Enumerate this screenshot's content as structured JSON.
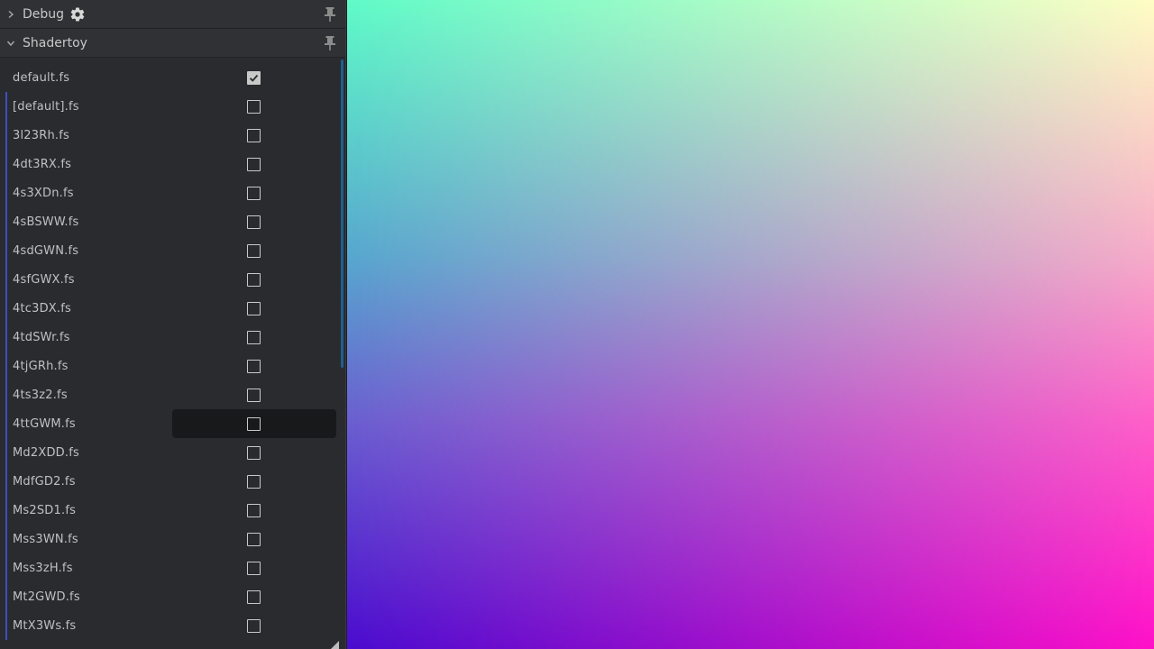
{
  "sections": {
    "debug": {
      "title": "Debug",
      "expanded": false
    },
    "shadertoy": {
      "title": "Shadertoy",
      "expanded": true
    }
  },
  "shaders": [
    {
      "name": "default.fs",
      "checked": true
    },
    {
      "name": "[default].fs",
      "checked": false
    },
    {
      "name": "3l23Rh.fs",
      "checked": false
    },
    {
      "name": "4dt3RX.fs",
      "checked": false
    },
    {
      "name": "4s3XDn.fs",
      "checked": false
    },
    {
      "name": "4sBSWW.fs",
      "checked": false
    },
    {
      "name": "4sdGWN.fs",
      "checked": false
    },
    {
      "name": "4sfGWX.fs",
      "checked": false
    },
    {
      "name": "4tc3DX.fs",
      "checked": false
    },
    {
      "name": "4tdSWr.fs",
      "checked": false
    },
    {
      "name": "4tjGRh.fs",
      "checked": false
    },
    {
      "name": "4ts3z2.fs",
      "checked": false
    },
    {
      "name": "4ttGWM.fs",
      "checked": false,
      "hovered": true
    },
    {
      "name": "Md2XDD.fs",
      "checked": false
    },
    {
      "name": "MdfGD2.fs",
      "checked": false
    },
    {
      "name": "Ms2SD1.fs",
      "checked": false
    },
    {
      "name": "Mss3WN.fs",
      "checked": false
    },
    {
      "name": "Mss3zH.fs",
      "checked": false
    },
    {
      "name": "Mt2GWD.fs",
      "checked": false
    },
    {
      "name": "MtX3Ws.fs",
      "checked": false
    }
  ],
  "colors": {
    "panel_bg": "#2a2b2e",
    "accent_bar": "#3d4fbf",
    "scrollbar": "#1f5f8f",
    "viewport_top_left": "#5ffbc8",
    "viewport_top_right": "#fffdc4",
    "viewport_bottom_left": "#4a0ccf",
    "viewport_bottom_right": "#ff10c8"
  },
  "icons": {
    "debug_chevron": "chevron-right-icon",
    "shadertoy_chevron": "chevron-down-icon",
    "debug_settings": "gear-icon",
    "pin": "pin-icon",
    "resize": "resize-grip-icon"
  }
}
